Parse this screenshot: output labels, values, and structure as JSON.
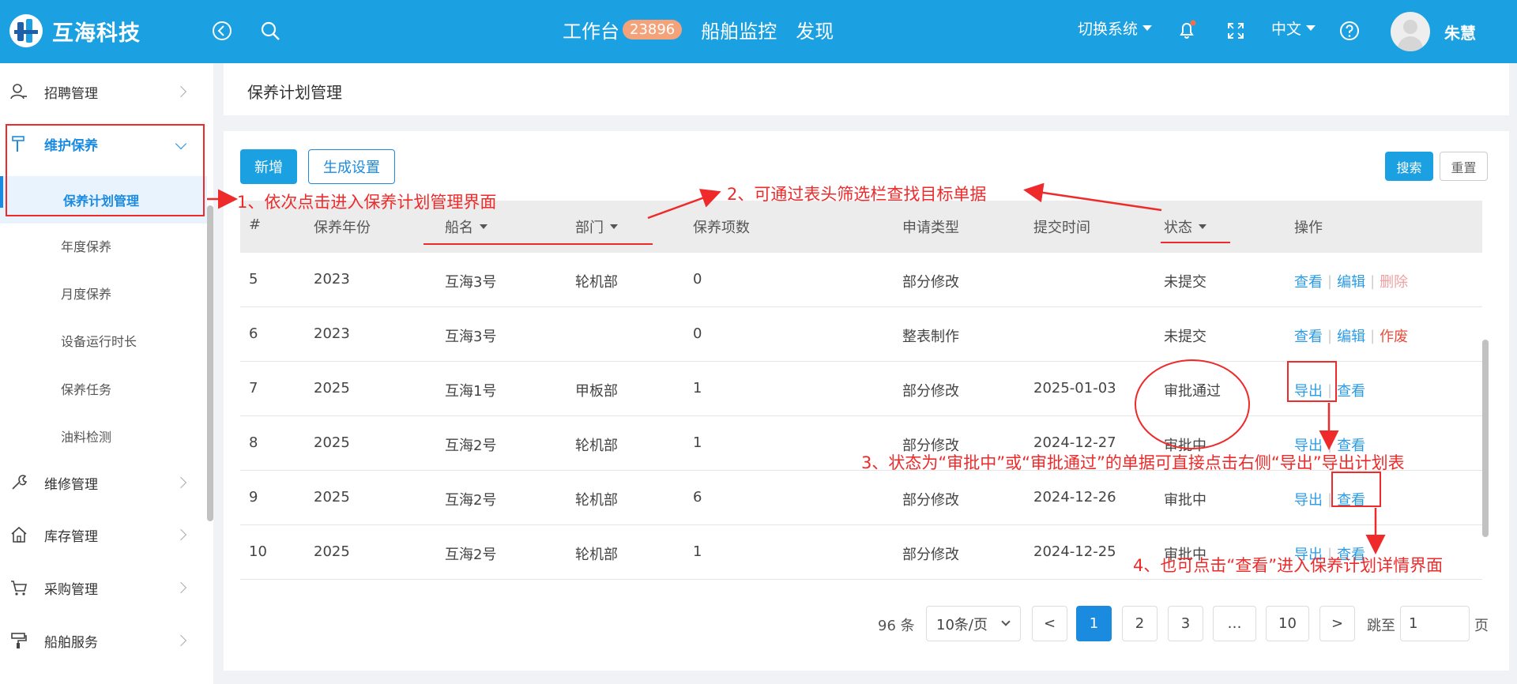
{
  "header": {
    "logo_text": "互海科技",
    "nav": [
      {
        "label": "工作台",
        "badge": "23896"
      },
      {
        "label": "船舶监控"
      },
      {
        "label": "发现"
      }
    ],
    "switch_system": "切换系统",
    "language": "中文",
    "user_name": "朱慧"
  },
  "sidebar": {
    "items": [
      {
        "label": "招聘管理",
        "icon": "user-icon"
      },
      {
        "label": "维护保养",
        "icon": "hammer-icon"
      },
      {
        "label": "维修管理",
        "icon": "wrench-icon"
      },
      {
        "label": "库存管理",
        "icon": "home-icon"
      },
      {
        "label": "采购管理",
        "icon": "cart-icon"
      },
      {
        "label": "船舶服务",
        "icon": "paint-roller-icon"
      }
    ],
    "sub_items": [
      "保养计划管理",
      "年度保养",
      "月度保养",
      "设备运行时长",
      "保养任务",
      "油料检测"
    ]
  },
  "page": {
    "title": "保养计划管理",
    "buttons": {
      "add": "新增",
      "gen_settings": "生成设置",
      "search": "搜索",
      "reset": "重置"
    }
  },
  "table": {
    "columns": [
      "#",
      "保养年份",
      "船名",
      "部门",
      "保养项数",
      "申请类型",
      "提交时间",
      "状态",
      "操作"
    ],
    "rows": [
      {
        "no": "5",
        "year": "2023",
        "ship": "互海3号",
        "dept": "轮机部",
        "count": "0",
        "type": "部分修改",
        "time": "",
        "status": "未提交",
        "actions": [
          "查看",
          "编辑",
          "删除"
        ]
      },
      {
        "no": "6",
        "year": "2023",
        "ship": "互海3号",
        "dept": "",
        "count": "0",
        "type": "整表制作",
        "time": "",
        "status": "未提交",
        "actions": [
          "查看",
          "编辑",
          "作废"
        ]
      },
      {
        "no": "7",
        "year": "2025",
        "ship": "互海1号",
        "dept": "甲板部",
        "count": "1",
        "type": "部分修改",
        "time": "2025-01-03",
        "status": "审批通过",
        "actions": [
          "导出",
          "查看"
        ]
      },
      {
        "no": "8",
        "year": "2025",
        "ship": "互海2号",
        "dept": "轮机部",
        "count": "1",
        "type": "部分修改",
        "time": "2024-12-27",
        "status": "审批中",
        "actions": [
          "导出",
          "查看"
        ]
      },
      {
        "no": "9",
        "year": "2025",
        "ship": "互海2号",
        "dept": "轮机部",
        "count": "6",
        "type": "部分修改",
        "time": "2024-12-26",
        "status": "审批中",
        "actions": [
          "导出",
          "查看"
        ]
      },
      {
        "no": "10",
        "year": "2025",
        "ship": "互海2号",
        "dept": "轮机部",
        "count": "1",
        "type": "部分修改",
        "time": "2024-12-25",
        "status": "审批中",
        "actions": [
          "导出",
          "查看"
        ]
      }
    ]
  },
  "pagination": {
    "total": "96 条",
    "page_size": "10条/页",
    "prev": "<",
    "next": ">",
    "pages": [
      "1",
      "2",
      "3",
      "…",
      "10"
    ],
    "jump_label": "跳至",
    "jump_value": "1",
    "page_suffix": "页"
  },
  "annotations": {
    "a1": "1、依次点击进入保养计划管理界面",
    "a2": "2、可通过表头筛选栏查找目标单据",
    "a3": "3、状态为“审批中”或“审批通过”的单据可直接点击右侧“导出”导出计划表",
    "a4": "4、也可点击“查看”进入保养计划详情界面"
  },
  "colors": {
    "brand": "#1ba1e2",
    "annotation": "#ee2a2a",
    "link": "#2b9be6"
  }
}
